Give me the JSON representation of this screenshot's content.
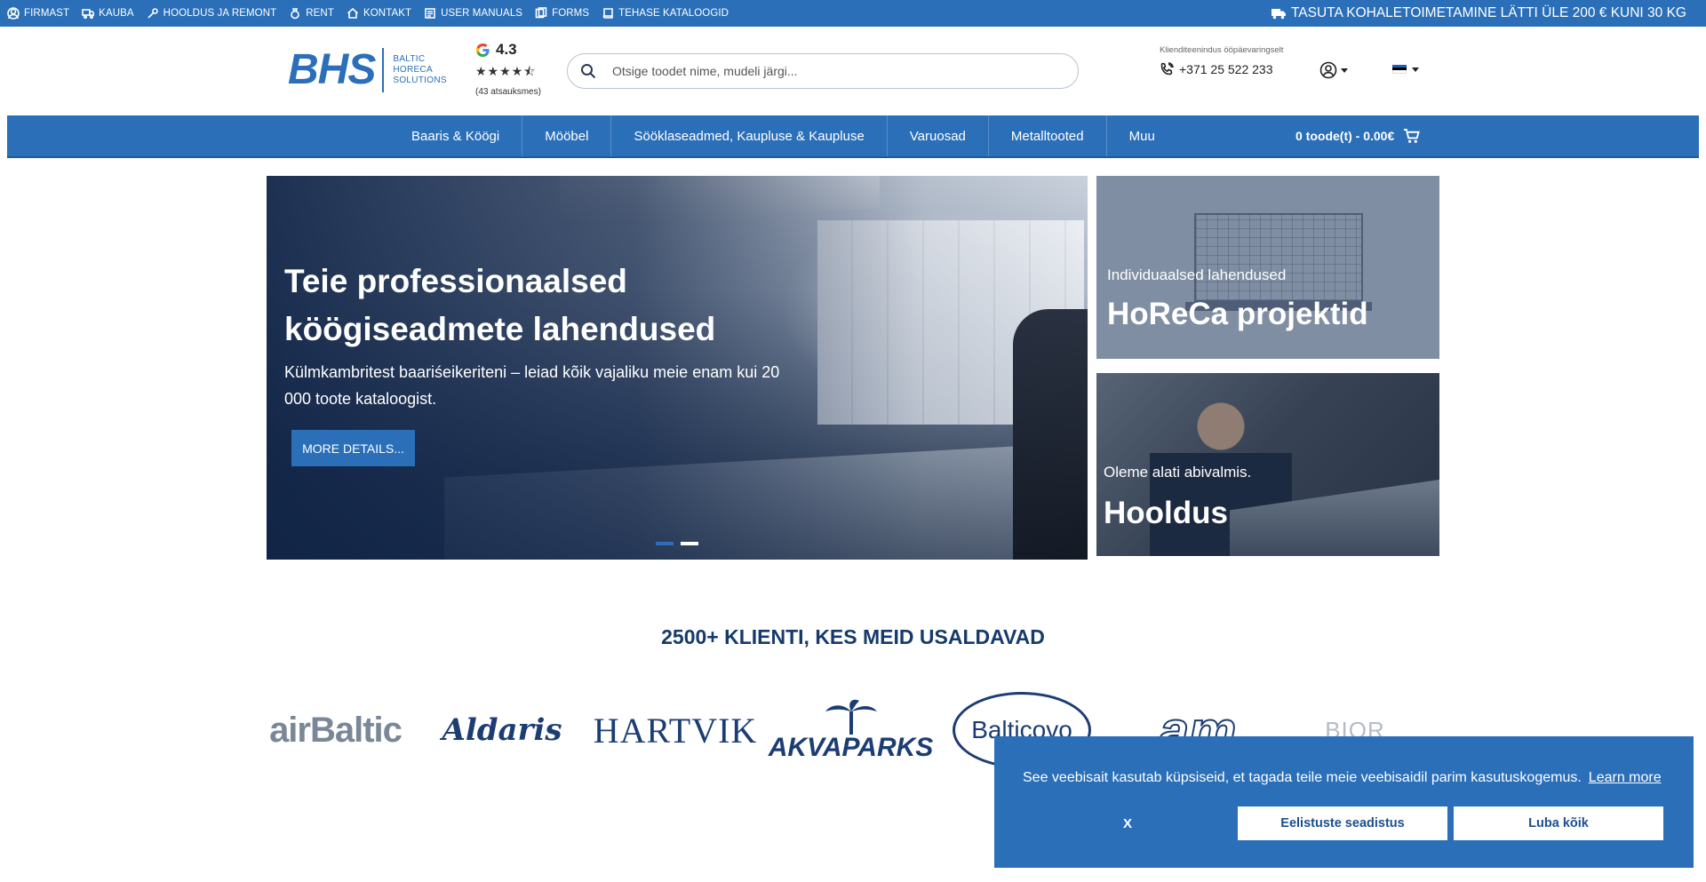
{
  "topbar": {
    "nav": [
      {
        "label": "FIRMAST",
        "icon": "user-badge-icon"
      },
      {
        "label": "KAUBA",
        "icon": "truck-icon"
      },
      {
        "label": "HOOLDUS JA REMONT",
        "icon": "wrench-icon"
      },
      {
        "label": "RENT",
        "icon": "ring-icon"
      },
      {
        "label": "KONTAKT",
        "icon": "home-icon"
      },
      {
        "label": "USER MANUALS",
        "icon": "manual-icon"
      },
      {
        "label": "FORMS",
        "icon": "forms-icon"
      },
      {
        "label": "TEHASE KATALOOGID",
        "icon": "book-icon"
      }
    ],
    "promo": "TASUTA KOHALETOIMETAMINE LÄTTI ÜLE 200 € KUNI 30 KG"
  },
  "header": {
    "logo": {
      "mark": "BHS",
      "line1": "BALTIC",
      "line2": "HORECA",
      "line3": "SOLUTIONS"
    },
    "rating": {
      "value": "4.3",
      "stars": "★★★★⯪",
      "reviews": "(43 atsauksmes)"
    },
    "search": {
      "placeholder": "Otsige toodet nime, mudeli järgi..."
    },
    "support": {
      "label": "Klienditeenindus ööpäevaringselt",
      "phone": "+371 25 522 233"
    }
  },
  "mainnav": {
    "items": [
      "Baaris & Köögi",
      "Mööbel",
      "Sööklaseadmed, Kaupluse & Kaupluse",
      "Varuosad",
      "Metalltooted",
      "Muu"
    ],
    "cart": "0 toode(t) - 0.00€"
  },
  "hero": {
    "title": "Teie professionaalsed köögiseadmete lahendused",
    "description": "Külmkambritest baariśeikeriteni – leiad kõik vajaliku meie enam kui 20 000 toote kataloogist.",
    "button": "MORE DETAILS...",
    "slide_count": 2,
    "active_slide": 1
  },
  "cards": [
    {
      "subtitle": "Individuaalsed lahendused",
      "title": "HoReCa projektid"
    },
    {
      "subtitle": "Oleme alati abivalmis.",
      "title": "Hooldus"
    }
  ],
  "clients": {
    "title": "2500+ KLIENTI, KES MEID USALDAVAD",
    "logos": [
      "airBaltic",
      "Aldaris",
      "HARTVIK",
      "AKVAPARKS",
      "Balticovo",
      "am",
      "BIOR"
    ]
  },
  "cookie": {
    "message": "See veebisait kasutab küpsiseid, et tagada teile meie veebisaidil parim kasutuskogemus.",
    "learn_more": "Learn more",
    "dismiss": "X",
    "preferences": "Eelistuste seadistus",
    "allow_all": "Luba kõik"
  },
  "colors": {
    "brand": "#2a6fb8",
    "heading": "#153a6b",
    "flag_top": "#1f5fb4",
    "flag_mid": "#000000",
    "flag_bottom": "#ffffff"
  }
}
